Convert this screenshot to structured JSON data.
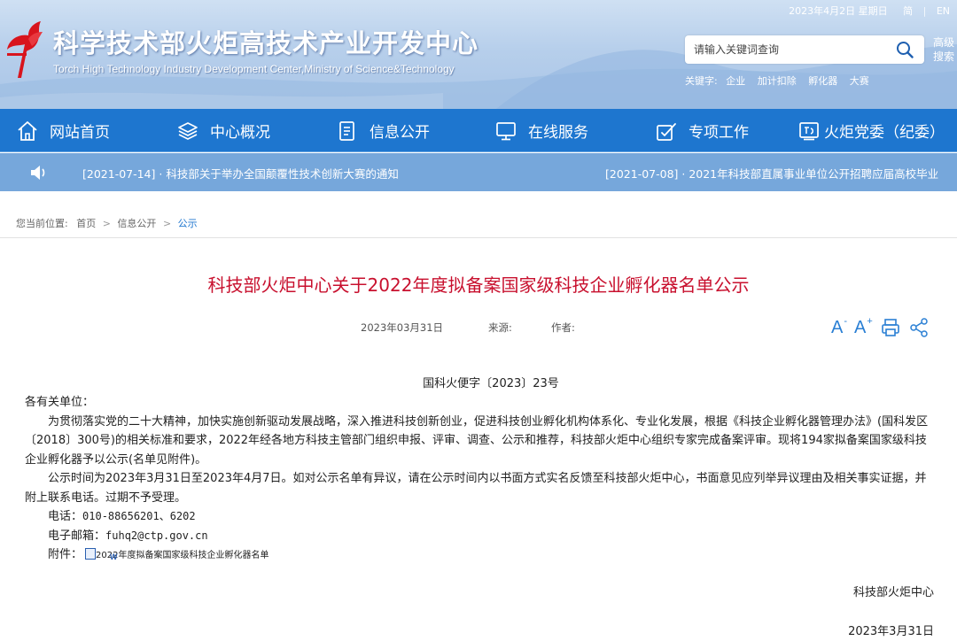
{
  "header": {
    "title": "科学技术部火炬高技术产业开发中心",
    "subtitle": "Torch High Technology Industry Development Center,Ministry of Science&Technology",
    "date": "2023年4月2日 星期日",
    "lang_simplified": "简",
    "lang_english": "EN",
    "search_placeholder": "请输入关键词查询",
    "advanced_search": "高级搜索",
    "keywords_label": "关键字:",
    "keywords": [
      "企业",
      "加计扣除",
      "孵化器",
      "大赛"
    ]
  },
  "nav": {
    "items": [
      {
        "label": "网站首页",
        "icon": "home-icon"
      },
      {
        "label": "中心概况",
        "icon": "layers-icon"
      },
      {
        "label": "信息公开",
        "icon": "document-icon"
      },
      {
        "label": "在线服务",
        "icon": "monitor-icon"
      },
      {
        "label": "专项工作",
        "icon": "task-icon"
      },
      {
        "label": "火炬党委（纪委）",
        "icon": "party-icon"
      }
    ]
  },
  "notice": {
    "left": "[2021-07-14] · 科技部关于举办全国颠覆性技术创新大赛的通知",
    "right": "[2021-07-08] · 2021年科技部直属事业单位公开招聘应届高校毕业"
  },
  "breadcrumb": {
    "label": "您当前位置:",
    "items": [
      "首页",
      "信息公开",
      "公示"
    ],
    "separator": ">"
  },
  "article": {
    "title": "科技部火炬中心关于2022年度拟备案国家级科技企业孵化器名单公示",
    "date": "2023年03月31日",
    "source_label": "来源:",
    "author_label": "作者:",
    "font_size_label": "A",
    "font_decrease_sup": "-",
    "font_increase_sup": "+",
    "doc_number": "国科火便字〔2023〕23号",
    "salutation": "各有关单位：",
    "para1": "为贯彻落实党的二十大精神，加快实施创新驱动发展战略，深入推进科技创新创业，促进科技创业孵化机构体系化、专业化发展，根据《科技企业孵化器管理办法》(国科发区〔2018〕300号)的相关标准和要求，2022年经各地方科技主管部门组织申报、评审、调查、公示和推荐，科技部火炬中心组织专家完成备案评审。现将194家拟备案国家级科技企业孵化器予以公示(名单见附件)。",
    "para2": "公示时间为2023年3月31日至2023年4月7日。如对公示名单有异议，请在公示时间内以书面方式实名反馈至科技部火炬中心，书面意见应列举异议理由及相关事实证据，并附上联系电话。过期不予受理。",
    "phone_label": "电话：",
    "phone": "010-88656201、6202",
    "email_label": "电子邮箱：",
    "email": "fuhq2@ctp.gov.cn",
    "attach_label": "附件：",
    "attach_name": "2022年度拟备案国家级科技企业孵化器名单",
    "signer": "科技部火炬中心",
    "sign_date": "2023年3月31日"
  },
  "colors": {
    "nav_blue": "#1e76cf",
    "notice_blue": "#76a7db",
    "title_red": "#c8102e",
    "logo_red": "#d8141d"
  }
}
